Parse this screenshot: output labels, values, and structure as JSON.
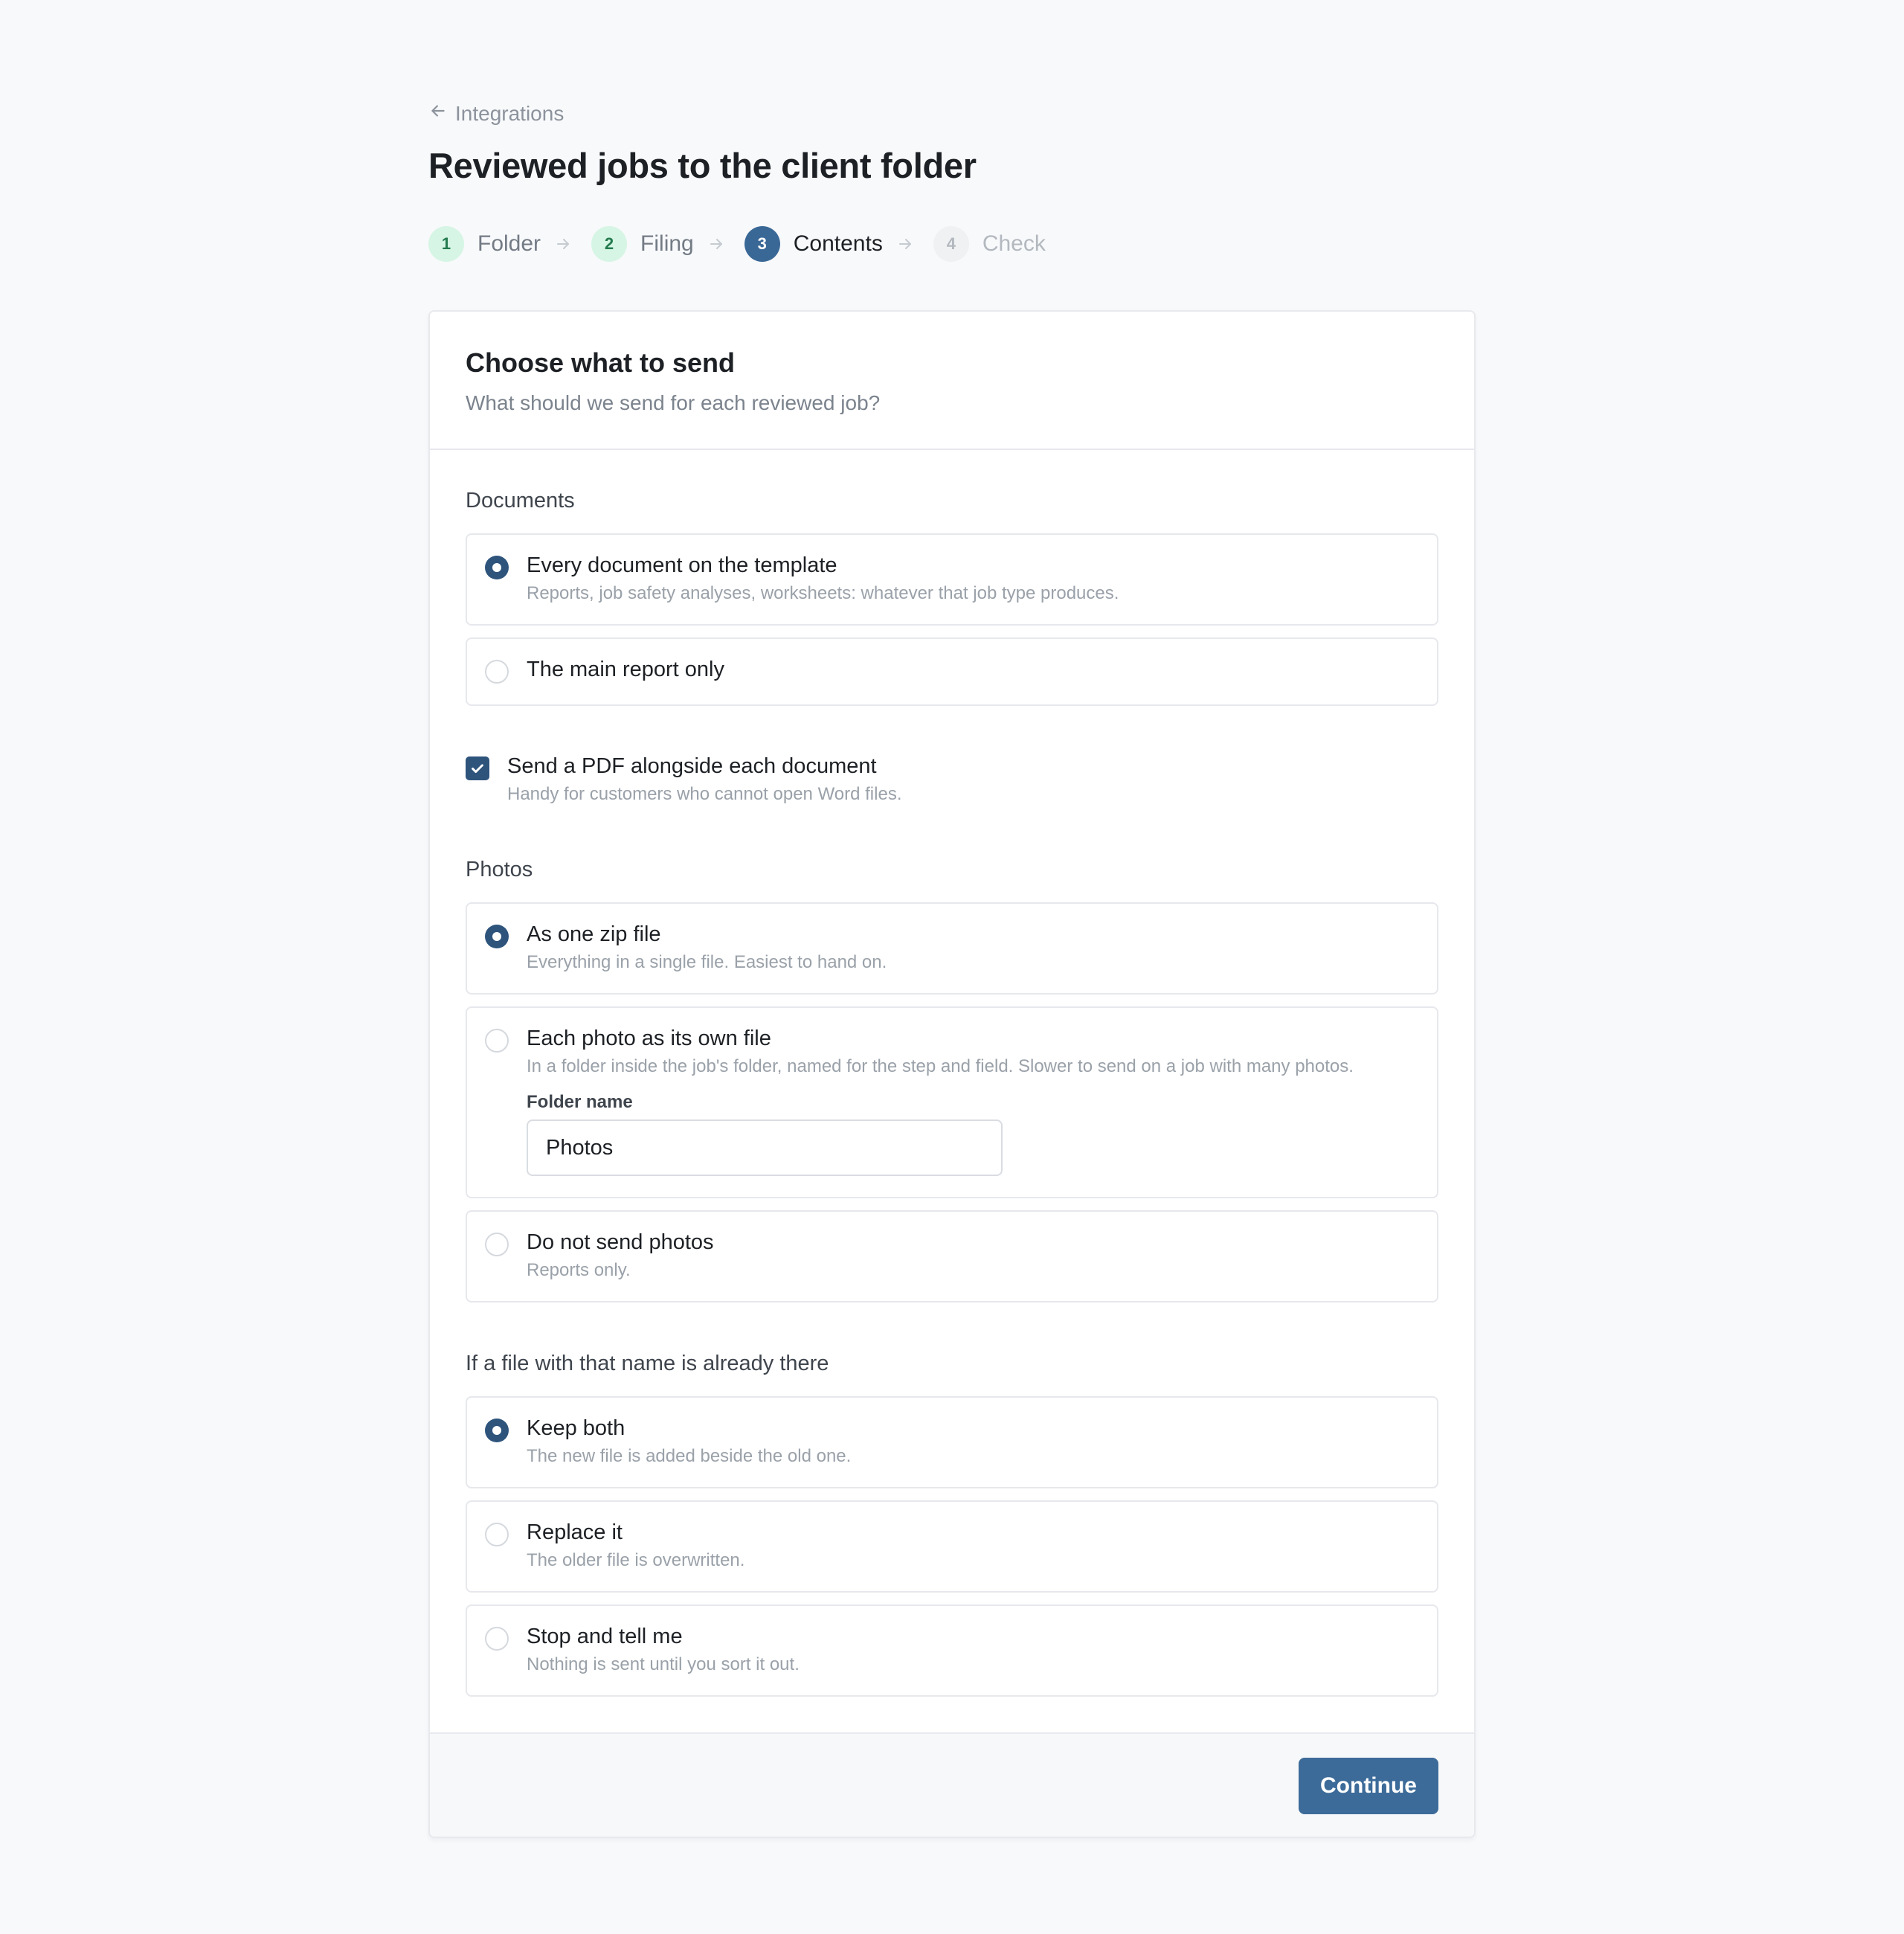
{
  "back_link": {
    "label": "Integrations",
    "icon": "arrow-left-icon"
  },
  "page_title": "Reviewed jobs to the client folder",
  "steps": [
    {
      "number": "1",
      "label": "Folder",
      "state": "done"
    },
    {
      "number": "2",
      "label": "Filing",
      "state": "done"
    },
    {
      "number": "3",
      "label": "Contents",
      "state": "current"
    },
    {
      "number": "4",
      "label": "Check",
      "state": "todo"
    }
  ],
  "card": {
    "title": "Choose what to send",
    "subtitle": "What should we send for each reviewed job?"
  },
  "documents": {
    "label": "Documents",
    "options": [
      {
        "title": "Every document on the template",
        "description": "Reports, job safety analyses, worksheets: whatever that job type produces.",
        "selected": true
      },
      {
        "title": "The main report only",
        "description": "",
        "selected": false
      }
    ],
    "pdf_checkbox": {
      "label": "Send a PDF alongside each document",
      "description": "Handy for customers who cannot open Word files.",
      "checked": true
    }
  },
  "photos": {
    "label": "Photos",
    "options": [
      {
        "title": "As one zip file",
        "description": "Everything in a single file. Easiest to hand on.",
        "selected": true
      },
      {
        "title": "Each photo as its own file",
        "description": "In a folder inside the job's folder, named for the step and field. Slower to send on a job with many photos.",
        "selected": false
      },
      {
        "title": "Do not send photos",
        "description": "Reports only.",
        "selected": false
      }
    ],
    "folder_name": {
      "label": "Folder name",
      "value": "Photos"
    }
  },
  "conflict": {
    "label": "If a file with that name is already there",
    "options": [
      {
        "title": "Keep both",
        "description": "The new file is added beside the old one.",
        "selected": true
      },
      {
        "title": "Replace it",
        "description": "The older file is overwritten.",
        "selected": false
      },
      {
        "title": "Stop and tell me",
        "description": "Nothing is sent until you sort it out.",
        "selected": false
      }
    ]
  },
  "footer": {
    "continue_label": "Continue"
  },
  "colors": {
    "accent": "#3c6b99",
    "radio_checked": "#2e547c",
    "step_done_bg": "#d6f5e4",
    "step_done_text": "#247a4e",
    "background": "#f8f9fb"
  }
}
